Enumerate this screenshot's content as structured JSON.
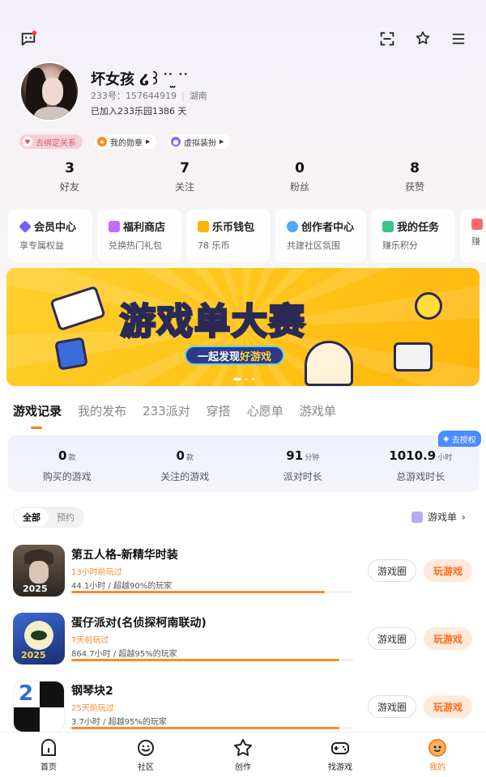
{
  "header": {
    "icons": [
      "message-icon",
      "scan-icon",
      "badge-icon",
      "menu-icon"
    ]
  },
  "profile": {
    "nickname": "坏女孩 ໒꒱ ͘ ͘ ̫ ͘ ͘",
    "uid_label": "233号：157644919",
    "region": "湖南",
    "joined": "已加入233乐园1386 天"
  },
  "pills": {
    "bind": "去绑定关系",
    "medal": "我的勋章",
    "avatar": "虚拟装扮"
  },
  "stats": [
    {
      "num": "3",
      "label": "好友"
    },
    {
      "num": "7",
      "label": "关注"
    },
    {
      "num": "0",
      "label": "粉丝"
    },
    {
      "num": "8",
      "label": "获赞"
    }
  ],
  "quick_cards": [
    {
      "title": "会员中心",
      "sub": "享专属权益",
      "color": "#7b5cff"
    },
    {
      "title": "福利商店",
      "sub": "兑换热门礼包",
      "color": "#c46bff"
    },
    {
      "title": "乐币钱包",
      "sub": "78 乐币",
      "color": "#ffb400"
    },
    {
      "title": "创作者中心",
      "sub": "共建社区氛围",
      "color": "#4aa8ff"
    },
    {
      "title": "我的任务",
      "sub": "赚乐积分",
      "color": "#3cc48a"
    },
    {
      "title": "",
      "sub": "赚",
      "color": "#ff6b6b"
    }
  ],
  "banner": {
    "title": "游戏单大赛",
    "sub_prefix": "一起发现",
    "sub_highlight": "好游戏"
  },
  "tabs": [
    "游戏记录",
    "我的发布",
    "233派对",
    "穿搭",
    "心愿单",
    "游戏单"
  ],
  "game_stats": [
    {
      "num": "0",
      "unit": "款",
      "label": "购买的游戏"
    },
    {
      "num": "0",
      "unit": "款",
      "label": "关注的游戏"
    },
    {
      "num": "91",
      "unit": "分钟",
      "label": "派对时长"
    },
    {
      "num": "1010.9",
      "unit": "小时",
      "label": "总游戏时长"
    }
  ],
  "authorize": "去授权",
  "filters": [
    "全部",
    "预约"
  ],
  "gamelist_link": "游戏单",
  "games": [
    {
      "name": "第五人格-新精华时装",
      "when": "13小时前玩过",
      "hours": "44.1小时 / 超越90%的玩家",
      "progress": 0.9,
      "circle": "游戏圈",
      "play": "玩游戏"
    },
    {
      "name": "蛋仔派对(名侦探柯南联动)",
      "when": "7天前玩过",
      "hours": "864.7小时 / 超越95%的玩家",
      "progress": 0.95,
      "circle": "游戏圈",
      "play": "玩游戏"
    },
    {
      "name": "钢琴块2",
      "when": "25天前玩过",
      "hours": "3.7小时 / 超越95%的玩家",
      "progress": 0.95,
      "circle": "游戏圈",
      "play": "玩游戏"
    }
  ],
  "bottom_nav": [
    {
      "label": "首页",
      "icon": "home-icon"
    },
    {
      "label": "社区",
      "icon": "community-icon"
    },
    {
      "label": "创作",
      "icon": "create-icon"
    },
    {
      "label": "找游戏",
      "icon": "gamepad-icon"
    },
    {
      "label": "我的",
      "icon": "profile-icon"
    }
  ],
  "colors": {
    "accent": "#ff7a1a",
    "auth_blue": "#4a8bff"
  }
}
